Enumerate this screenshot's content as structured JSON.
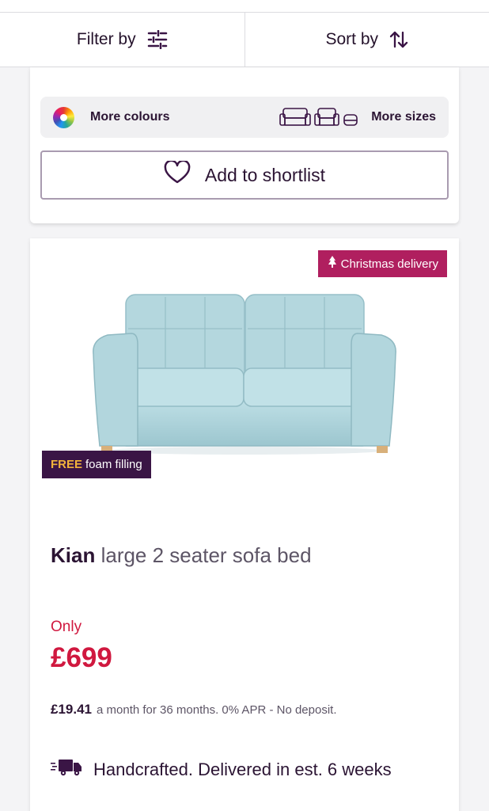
{
  "toolbar": {
    "filter_label": "Filter by",
    "sort_label": "Sort by"
  },
  "card1": {
    "more_colours_label": "More colours",
    "more_sizes_label": "More sizes",
    "shortlist_label": "Add to shortlist"
  },
  "product": {
    "badge_delivery": "Christmas delivery",
    "badge_free": "FREE",
    "badge_free_rest": "foam filling",
    "brand": "Kian",
    "name": "large 2 seater sofa bed",
    "price_prefix": "Only",
    "price": "£699",
    "finance_amount": "£19.41",
    "finance_text": "a month for 36 months. 0% APR - No deposit.",
    "delivery_text": "Handcrafted. Delivered in est. 6 weeks"
  },
  "colors": {
    "brand_purple": "#2b1433",
    "price_red": "#d0183f",
    "xmas_badge": "#b01f5f",
    "foam_badge": "#3a1545",
    "sofa": "#b6d9df"
  },
  "icons": [
    "filter-sliders-icon",
    "sort-arrows-icon",
    "colour-wheel-icon",
    "sofa-size-icon",
    "heart-icon",
    "tree-icon",
    "delivery-truck-icon"
  ]
}
